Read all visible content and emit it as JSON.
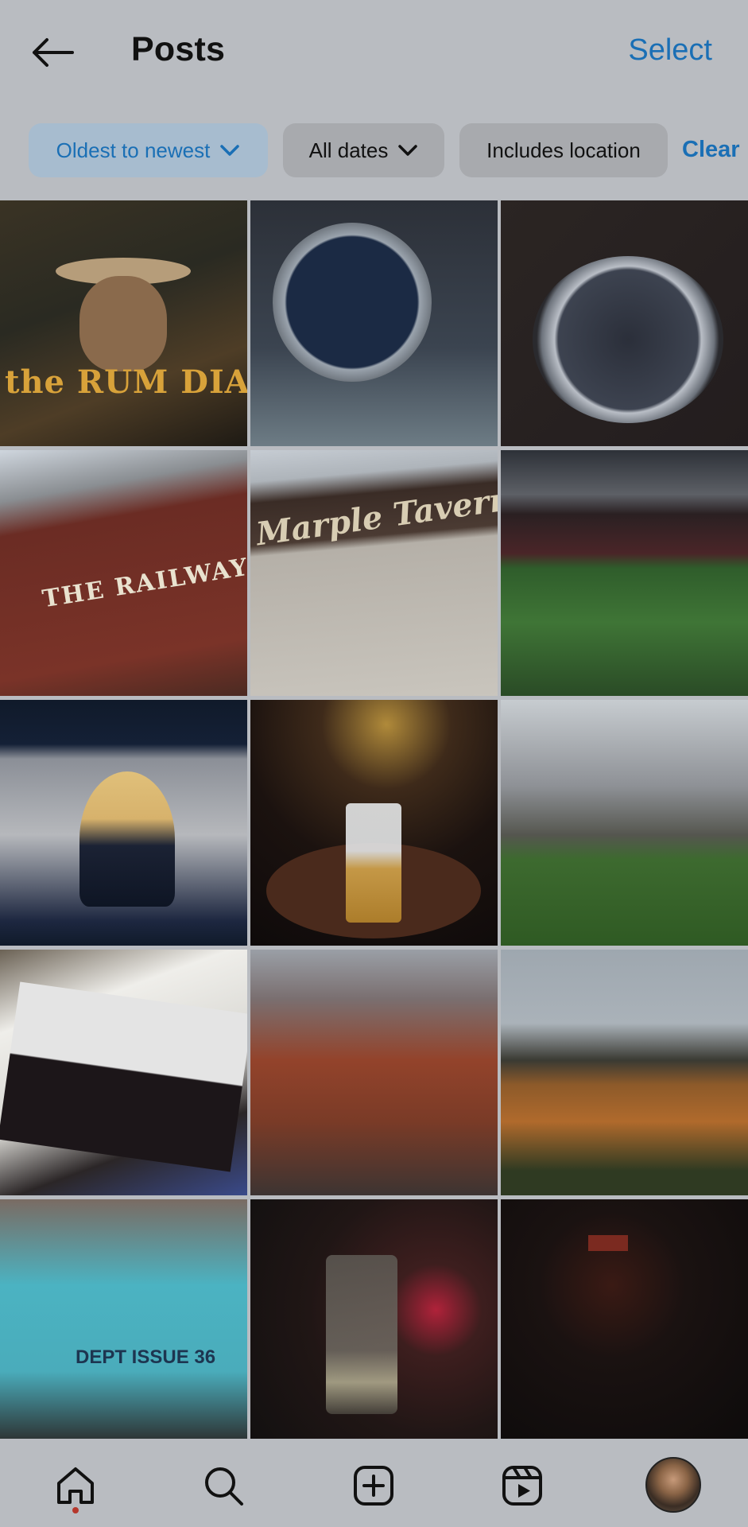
{
  "header": {
    "back_icon": "arrow-left-icon",
    "title": "Posts",
    "select_label": "Select"
  },
  "filters": {
    "sort_label": "Oldest to newest",
    "dates_label": "All dates",
    "location_label": "Includes location",
    "clear_label": "Clear",
    "accent_color": "#1a6fb5"
  },
  "grid": {
    "tiles": [
      {
        "caption": "the RUM DIARY"
      },
      {
        "caption": ""
      },
      {
        "caption": ""
      },
      {
        "caption": "THE RAILWAY"
      },
      {
        "caption": "Marple Tavern"
      },
      {
        "caption": ""
      },
      {
        "caption": ""
      },
      {
        "caption": ""
      },
      {
        "caption": ""
      },
      {
        "caption": ""
      },
      {
        "caption": ""
      },
      {
        "caption": ""
      },
      {
        "caption": "DEPT ISSUE 36"
      },
      {
        "caption": ""
      },
      {
        "caption": ""
      }
    ]
  },
  "nav": {
    "home_icon": "home-icon",
    "search_icon": "search-icon",
    "create_icon": "plus-square-icon",
    "reels_icon": "reels-icon",
    "profile_icon": "avatar"
  }
}
